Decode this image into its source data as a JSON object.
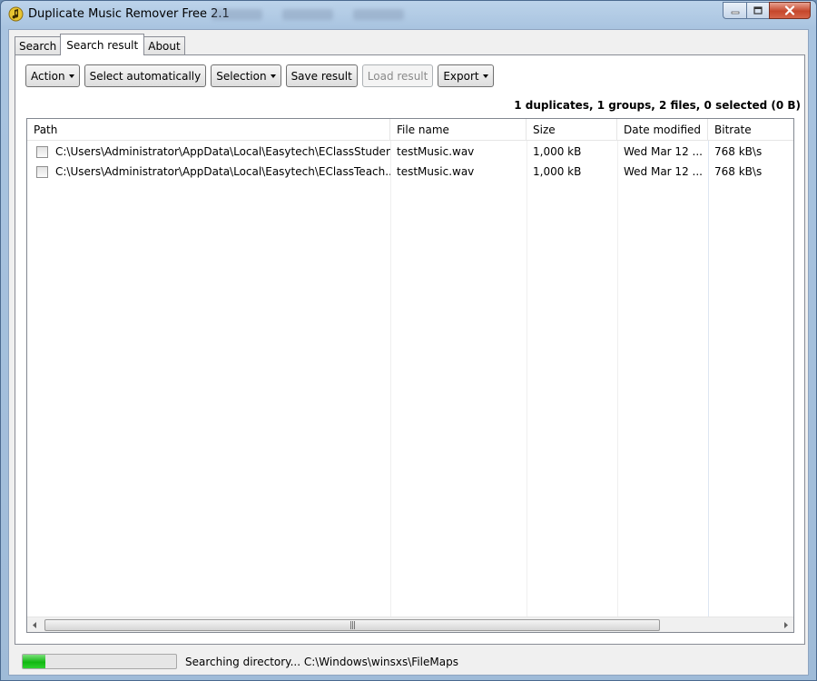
{
  "window": {
    "title": "Duplicate Music Remover Free 2.1"
  },
  "tabs": [
    {
      "label": "Search",
      "active": false
    },
    {
      "label": "Search result",
      "active": true
    },
    {
      "label": "About",
      "active": false
    }
  ],
  "toolbar": {
    "action": "Action",
    "select_automatically": "Select automatically",
    "selection": "Selection",
    "save_result": "Save result",
    "load_result": "Load result",
    "export": "Export"
  },
  "summary": "1 duplicates, 1 groups, 2 files, 0 selected (0 B)",
  "table": {
    "columns": [
      "Path",
      "File name",
      "Size",
      "Date modified",
      "Bitrate"
    ],
    "rows": [
      {
        "path": "C:\\Users\\Administrator\\AppData\\Local\\Easytech\\EClassStudent",
        "file_name": "testMusic.wav",
        "size": "1,000 kB",
        "date_modified": "Wed Mar 12 ...",
        "bitrate": "768 kB\\s",
        "checked": false
      },
      {
        "path": "C:\\Users\\Administrator\\AppData\\Local\\Easytech\\EClassTeach...",
        "file_name": "testMusic.wav",
        "size": "1,000 kB",
        "date_modified": "Wed Mar 12 ...",
        "bitrate": "768 kB\\s",
        "checked": false
      }
    ]
  },
  "status": {
    "text": "Searching directory... C:\\Windows\\winsxs\\FileMaps",
    "progress_fraction": 0.15
  },
  "colors": {
    "progress_green": "#12b812",
    "close_button_red": "#c5472c"
  }
}
